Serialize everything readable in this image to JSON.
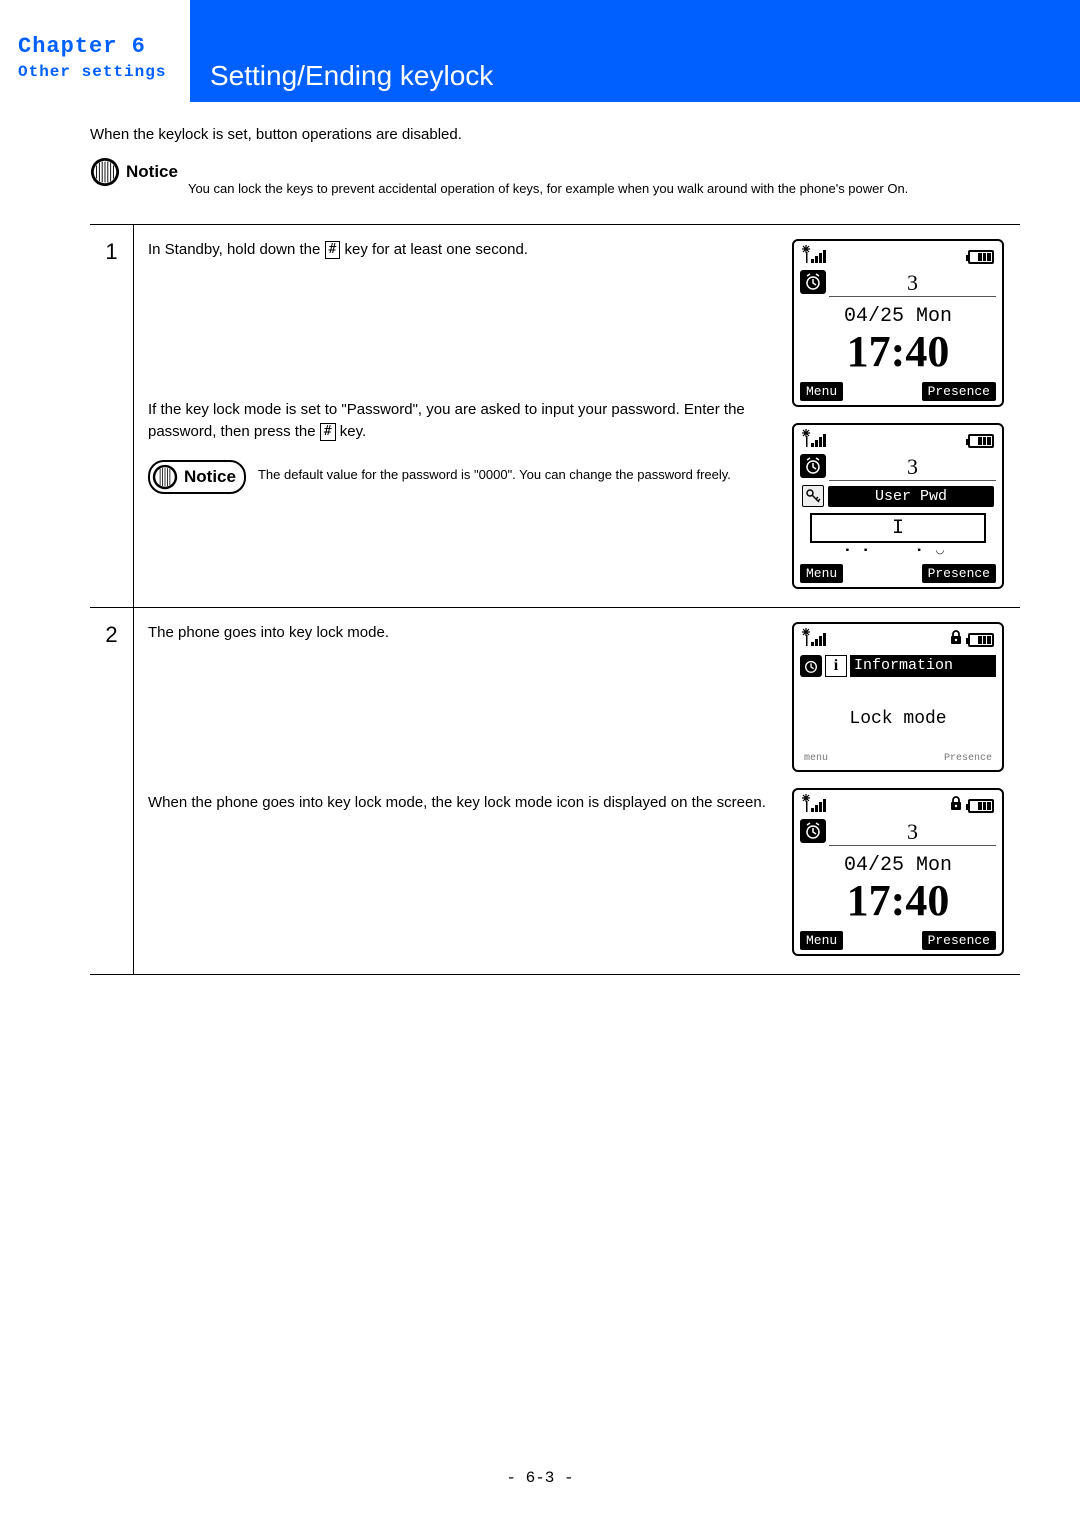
{
  "chapter": {
    "title": "Chapter 6",
    "subtitle": "Other settings"
  },
  "page_title": "Setting/Ending keylock",
  "intro": "When the keylock is set, button operations are disabled.",
  "notice_label": "Notice",
  "top_notice": "You can lock the keys to prevent accidental operation of keys, for example when you walk around with the phone's power On.",
  "key_hash": "#",
  "step1": {
    "num": "1",
    "line1a": "In Standby, hold down the ",
    "line1b": " key for at least one second.",
    "line2a": "If the key lock mode is set to \"Password\", you are asked to input your password. Enter the password,  then press the ",
    "line2b": " key.",
    "inner_notice": "The default value for the password is \"0000\". You can change the password freely."
  },
  "step2": {
    "num": "2",
    "line1": "The phone goes into key lock mode.",
    "line2": "When the phone goes into key lock mode, the key lock mode icon is displayed on the screen."
  },
  "screens": {
    "line_number": "3",
    "date": "04/25 Mon",
    "time": "17:40",
    "soft_left": "Menu",
    "soft_right": "Presence",
    "pw_label": "User Pwd",
    "pw_cursor": "I",
    "info_label": "Information",
    "info_body": "Lock mode",
    "ghost_left": "menu",
    "ghost_right": "Presence"
  },
  "page_number": "- 6-3 -"
}
